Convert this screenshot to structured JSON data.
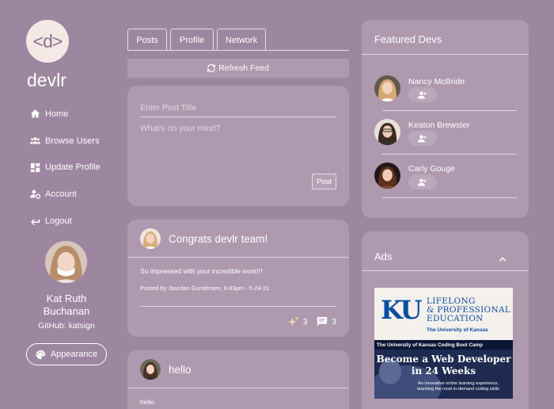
{
  "app": {
    "logo_text": "<d>",
    "brand": "devlr"
  },
  "sidebar": {
    "items": [
      {
        "label": "Home",
        "icon": "home-icon"
      },
      {
        "label": "Browse Users",
        "icon": "users-icon"
      },
      {
        "label": "Update Profile",
        "icon": "dashboard-icon"
      },
      {
        "label": "Account",
        "icon": "user-gear-icon"
      },
      {
        "label": "Logout",
        "icon": "logout-arrow-icon"
      }
    ],
    "user": {
      "name": "Kat Ruth Buchanan",
      "github": "GitHub: katsign"
    },
    "appearance_label": "Appearance"
  },
  "feed": {
    "tabs": [
      {
        "label": "Posts"
      },
      {
        "label": "Profile"
      },
      {
        "label": "Network"
      }
    ],
    "refresh_label": "Refresh Feed",
    "composer": {
      "title_placeholder": "Enter Post Title",
      "body_placeholder": "What's on your mind?",
      "post_label": "Post"
    },
    "posts": [
      {
        "title": "Congrats devlr team!",
        "body": "So impressed with your incredible work!!!",
        "meta": "Posted by Jourdan Gundersen, 6:43pm - 5-24-21",
        "likes": "3",
        "comments": "3"
      },
      {
        "title": "hello",
        "body": "hello"
      }
    ]
  },
  "featured": {
    "title": "Featured Devs",
    "devs": [
      {
        "name": "Nancy McBride"
      },
      {
        "name": "Keaton Brewster"
      },
      {
        "name": "Carly Gouge"
      }
    ]
  },
  "ads": {
    "title": "Ads",
    "ad": {
      "logo": "KU",
      "line1": "LIFELONG",
      "line2": "& PROFESSIONAL",
      "line3": "EDUCATION",
      "line4": "The University of Kansas",
      "banner": "The University of Kansas Coding Boot Camp",
      "headline1": "Become a Web Developer",
      "headline2": "in 24 Weeks",
      "sub1": "An innovative online learning experience,",
      "sub2": "teaching the most in-demand coding skills"
    }
  },
  "colors": {
    "background": "#9d869f",
    "card": "#ae99af",
    "logo_bg": "#f4e9e4",
    "ku_blue": "#0c4da2"
  }
}
